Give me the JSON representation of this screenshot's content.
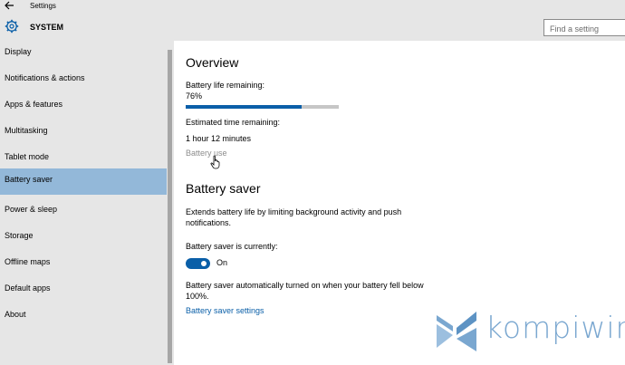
{
  "window": {
    "title": "Settings",
    "back_icon": "back-arrow-icon"
  },
  "header": {
    "section_title": "SYSTEM",
    "section_icon": "gear-icon",
    "search_placeholder": "Find a setting"
  },
  "sidebar": {
    "items": [
      {
        "label": "Display",
        "active": false
      },
      {
        "label": "Notifications & actions",
        "active": false
      },
      {
        "label": "Apps & features",
        "active": false
      },
      {
        "label": "Multitasking",
        "active": false
      },
      {
        "label": "Tablet mode",
        "active": false
      },
      {
        "label": "Battery saver",
        "active": true
      },
      {
        "label": "Power & sleep",
        "active": false
      },
      {
        "label": "Storage",
        "active": false
      },
      {
        "label": "Offline maps",
        "active": false
      },
      {
        "label": "Default apps",
        "active": false
      },
      {
        "label": "About",
        "active": false
      }
    ]
  },
  "overview": {
    "heading": "Overview",
    "battery_life_label": "Battery life remaining:",
    "battery_percent_text": "76%",
    "battery_level": 0.76,
    "estimated_label": "Estimated time remaining:",
    "estimated_value": "1 hour 12 minutes",
    "battery_use_link": "Battery use"
  },
  "battery_saver": {
    "heading": "Battery saver",
    "description": "Extends battery life by limiting background activity and push notifications.",
    "status_label": "Battery saver is currently:",
    "toggle_state": "On",
    "auto_note": "Battery saver automatically turned on when your battery fell below 100%.",
    "settings_link": "Battery saver settings"
  },
  "watermark": {
    "text": "kompiwin"
  },
  "colors": {
    "accent": "#0a5fa8",
    "selection": "#93b8d9",
    "chrome": "#e6e6e6",
    "watermark": "#7aa7d0"
  }
}
